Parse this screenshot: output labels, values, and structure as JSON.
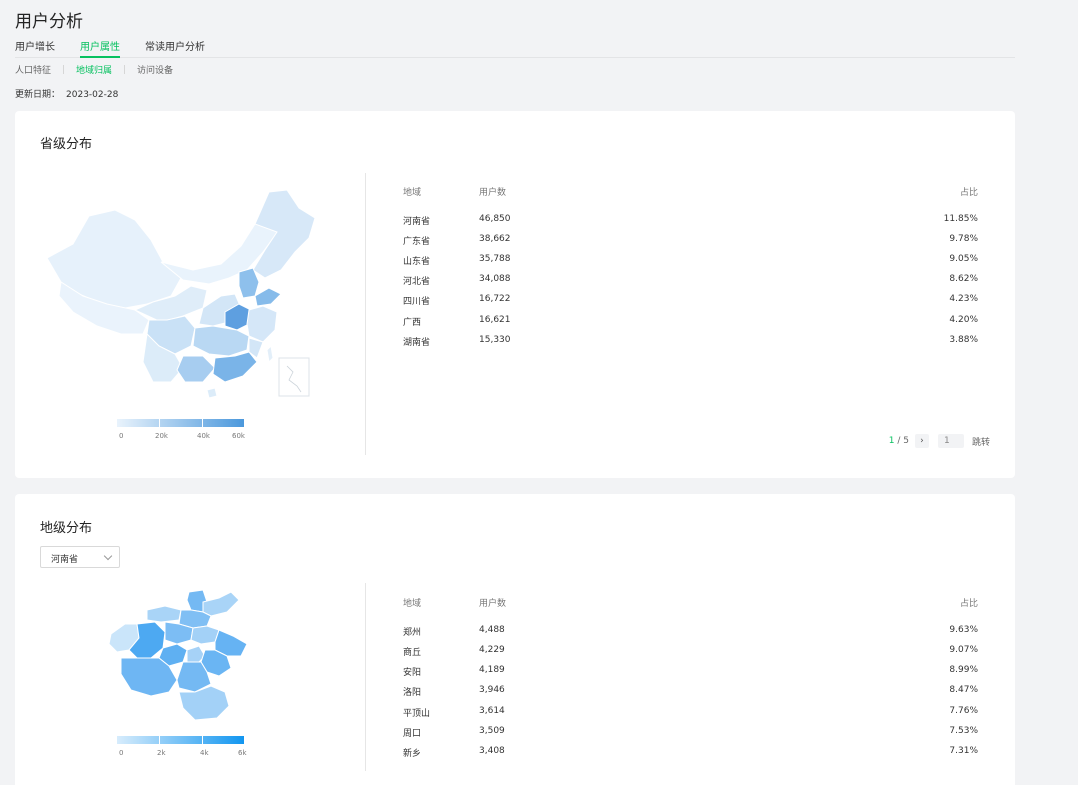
{
  "page": {
    "title": "用户分析"
  },
  "tabs": [
    "用户增长",
    "用户属性",
    "常读用户分析"
  ],
  "active_tab": "用户属性",
  "subtabs": [
    "人口特征",
    "地域归属",
    "访问设备"
  ],
  "active_subtab": "地域归属",
  "update": {
    "label": "更新日期：",
    "date": "2023-02-28"
  },
  "colors": {
    "accent": "#07c160",
    "map_low": "#e9f3fc",
    "map_high": "#4b98dc",
    "map2_high": "#1296f0"
  },
  "province_section": {
    "title": "省级分布",
    "headers": {
      "region": "地域",
      "users": "用户数",
      "ratio": "占比"
    },
    "rows": [
      {
        "region": "河南省",
        "users": "46,850",
        "ratio": "11.85%"
      },
      {
        "region": "广东省",
        "users": "38,662",
        "ratio": "9.78%"
      },
      {
        "region": "山东省",
        "users": "35,788",
        "ratio": "9.05%"
      },
      {
        "region": "河北省",
        "users": "34,088",
        "ratio": "8.62%"
      },
      {
        "region": "四川省",
        "users": "16,722",
        "ratio": "4.23%"
      },
      {
        "region": "广西",
        "users": "16,621",
        "ratio": "4.20%"
      },
      {
        "region": "湖南省",
        "users": "15,330",
        "ratio": "3.88%"
      }
    ],
    "legend": [
      "0",
      "20k",
      "40k",
      "60k"
    ],
    "pager": {
      "current": "1",
      "total": "5",
      "sep": " / ",
      "next": "›",
      "input_value": "1",
      "jump": "跳转"
    }
  },
  "city_section": {
    "title": "地级分布",
    "select_value": "河南省",
    "headers": {
      "region": "地域",
      "users": "用户数",
      "ratio": "占比"
    },
    "rows": [
      {
        "region": "郑州",
        "users": "4,488",
        "ratio": "9.63%"
      },
      {
        "region": "商丘",
        "users": "4,229",
        "ratio": "9.07%"
      },
      {
        "region": "安阳",
        "users": "4,189",
        "ratio": "8.99%"
      },
      {
        "region": "洛阳",
        "users": "3,946",
        "ratio": "8.47%"
      },
      {
        "region": "平顶山",
        "users": "3,614",
        "ratio": "7.76%"
      },
      {
        "region": "周口",
        "users": "3,509",
        "ratio": "7.53%"
      },
      {
        "region": "新乡",
        "users": "3,408",
        "ratio": "7.31%"
      }
    ],
    "legend": [
      "0",
      "2k",
      "4k",
      "6k"
    ]
  }
}
